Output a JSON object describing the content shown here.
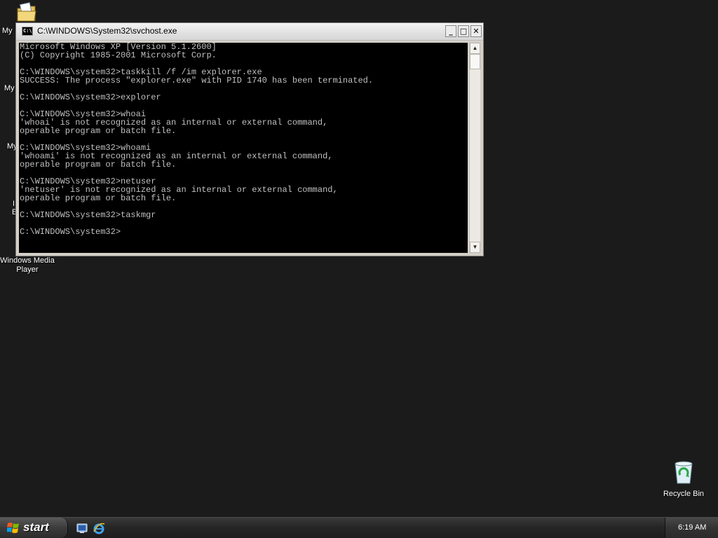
{
  "desktop": {
    "icons": {
      "my_documents_partial": "My",
      "my_computer_partial": "My",
      "my_network_partial": "My",
      "ie_partial_1": "I",
      "ie_partial_2": "E",
      "windows_media_player": "Windows Media Player",
      "recycle_bin": "Recycle Bin"
    }
  },
  "window": {
    "title": "C:\\WINDOWS\\System32\\svchost.exe",
    "buttons": {
      "minimize": "_",
      "maximize": "□",
      "close": "✕"
    },
    "console_text": "Microsoft Windows XP [Version 5.1.2600]\n(C) Copyright 1985-2001 Microsoft Corp.\n\nC:\\WINDOWS\\system32>taskkill /f /im explorer.exe\nSUCCESS: The process \"explorer.exe\" with PID 1740 has been terminated.\n\nC:\\WINDOWS\\system32>explorer\n\nC:\\WINDOWS\\system32>whoai\n'whoai' is not recognized as an internal or external command,\noperable program or batch file.\n\nC:\\WINDOWS\\system32>whoami\n'whoami' is not recognized as an internal or external command,\noperable program or batch file.\n\nC:\\WINDOWS\\system32>netuser\n'netuser' is not recognized as an internal or external command,\noperable program or batch file.\n\nC:\\WINDOWS\\system32>taskmgr\n\nC:\\WINDOWS\\system32>"
  },
  "taskbar": {
    "start_label": "start",
    "clock": "6:19 AM"
  },
  "colors": {
    "desktop_bg": "#1b1b1b",
    "console_bg": "#000000",
    "console_text": "#c0c0c0"
  },
  "icons": {
    "window_icon": "console-icon",
    "start_icon": "windows-flag-icon",
    "quicklaunch": [
      "show-desktop-icon",
      "internet-explorer-icon"
    ],
    "desktop": [
      "my-documents-icon",
      "recycle-bin-icon"
    ]
  }
}
